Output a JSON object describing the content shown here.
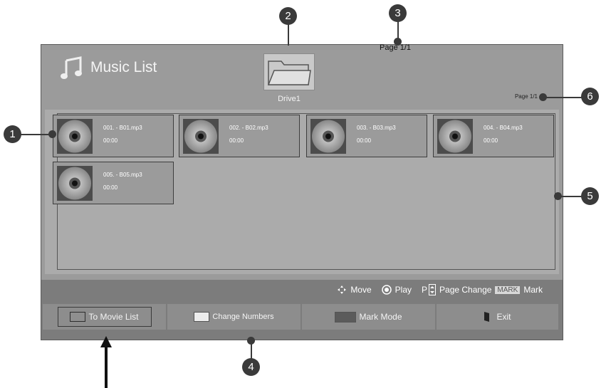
{
  "screen": {
    "title": "Music List",
    "folder_label": "Drive1",
    "page_top": "Page 1/1",
    "page_small": "Page 1/1",
    "items": [
      {
        "name": "001. - B01.mp3",
        "time": "00:00"
      },
      {
        "name": "002. - B02.mp3",
        "time": "00:00"
      },
      {
        "name": "003. - B03.mp3",
        "time": "00:00"
      },
      {
        "name": "004. - B04.mp3",
        "time": "00:00"
      },
      {
        "name": "005. - B05.mp3",
        "time": "00:00"
      }
    ]
  },
  "controls": {
    "move": "Move",
    "play": "Play",
    "p": "P",
    "page_change": "Page Change",
    "mark_key": "MARK",
    "mark": "Mark"
  },
  "buttons": [
    {
      "label": "To Movie List",
      "color": "#8f8f8f"
    },
    {
      "label": "Change Numbers",
      "color": "#ededed"
    },
    {
      "label": "Mark Mode",
      "color": "#5b5b5b"
    },
    {
      "label": "Exit",
      "color": "#222222"
    }
  ],
  "annotations": [
    "1",
    "2",
    "3",
    "4",
    "5",
    "6"
  ]
}
